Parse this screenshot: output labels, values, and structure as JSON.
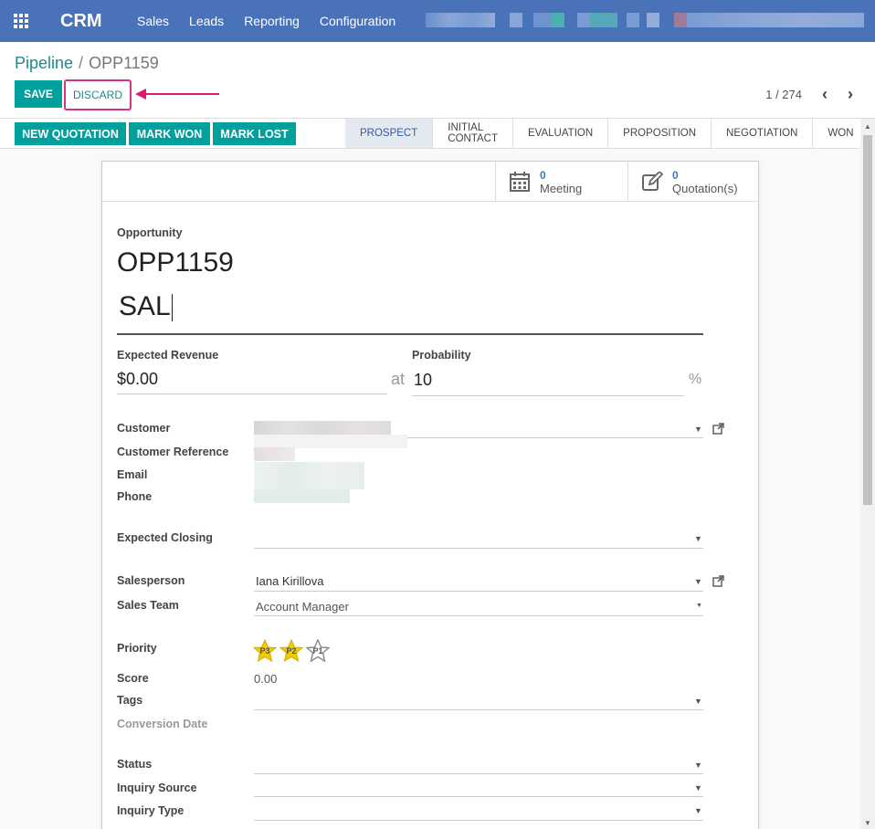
{
  "navbar": {
    "brand": "CRM",
    "menu": [
      "Sales",
      "Leads",
      "Reporting",
      "Configuration"
    ]
  },
  "breadcrumb": {
    "parent": "Pipeline",
    "separator": "/",
    "current": "OPP1159"
  },
  "toolbar": {
    "save_label": "SAVE",
    "discard_label": "DISCARD"
  },
  "pager": {
    "value": "1 / 274"
  },
  "actions": [
    "NEW QUOTATION",
    "MARK WON",
    "MARK LOST"
  ],
  "stages": [
    {
      "label": "PROSPECT",
      "active": true
    },
    {
      "label": "INITIAL CONTACT",
      "active": false
    },
    {
      "label": "EVALUATION",
      "active": false
    },
    {
      "label": "PROPOSITION",
      "active": false
    },
    {
      "label": "NEGOTIATION",
      "active": false
    },
    {
      "label": "WON",
      "active": false
    }
  ],
  "stat_buttons": {
    "meeting": {
      "count": "0",
      "label": "Meeting"
    },
    "quotations": {
      "count": "0",
      "label": "Quotation(s)"
    }
  },
  "form": {
    "opportunity_label": "Opportunity",
    "opportunity_name": "OPP1159",
    "title_value": "SAL",
    "expected_revenue_label": "Expected Revenue",
    "expected_revenue_value": "$0.00",
    "at_label": "at",
    "probability_label": "Probability",
    "probability_value": "10",
    "percent_label": "%",
    "customer_label": "Customer",
    "customer_reference_label": "Customer Reference",
    "email_label": "Email",
    "phone_label": "Phone",
    "expected_closing_label": "Expected Closing",
    "salesperson_label": "Salesperson",
    "salesperson_value": "Iana Kirillova",
    "sales_team_label": "Sales Team",
    "sales_team_value": "Account Manager",
    "priority_label": "Priority",
    "priority_stars": [
      "P3",
      "P2",
      "P1"
    ],
    "priority_filled": 2,
    "score_label": "Score",
    "score_value": "0.00",
    "tags_label": "Tags",
    "conversion_date_label": "Conversion Date",
    "status_label": "Status",
    "inquiry_source_label": "Inquiry Source",
    "inquiry_type_label": "Inquiry Type"
  },
  "colors": {
    "navbar": "#4a72b8",
    "primary_button": "#00a09d",
    "highlight": "#d63384",
    "star": "#f3cc00"
  }
}
